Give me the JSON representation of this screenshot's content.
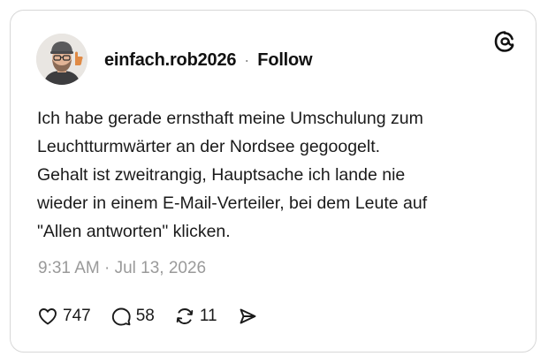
{
  "post": {
    "username": "einfach.rob2026",
    "separator": "·",
    "follow_label": "Follow",
    "text_lines": [
      "Ich habe gerade ernsthaft meine Umschulung zum",
      "Leuchtturmwärter an der Nordsee gegoogelt.",
      "Gehalt ist zweitrangig, Hauptsache ich lande nie",
      "wieder in einem E-Mail-Verteiler, bei dem Leute auf",
      "\"Allen antworten\" klicken."
    ],
    "timestamp": "9:31 AM · Jul 13, 2026"
  },
  "actions": {
    "likes": "747",
    "replies": "58",
    "reposts": "11"
  },
  "icons": {
    "logo": "threads-logo-icon",
    "like": "heart-icon",
    "reply": "speech-bubble-icon",
    "repost": "repost-arrows-icon",
    "share": "send-icon"
  },
  "colors": {
    "text": "#111111",
    "muted": "#9a9a9a",
    "border": "#d7d7d7",
    "background": "#ffffff"
  }
}
